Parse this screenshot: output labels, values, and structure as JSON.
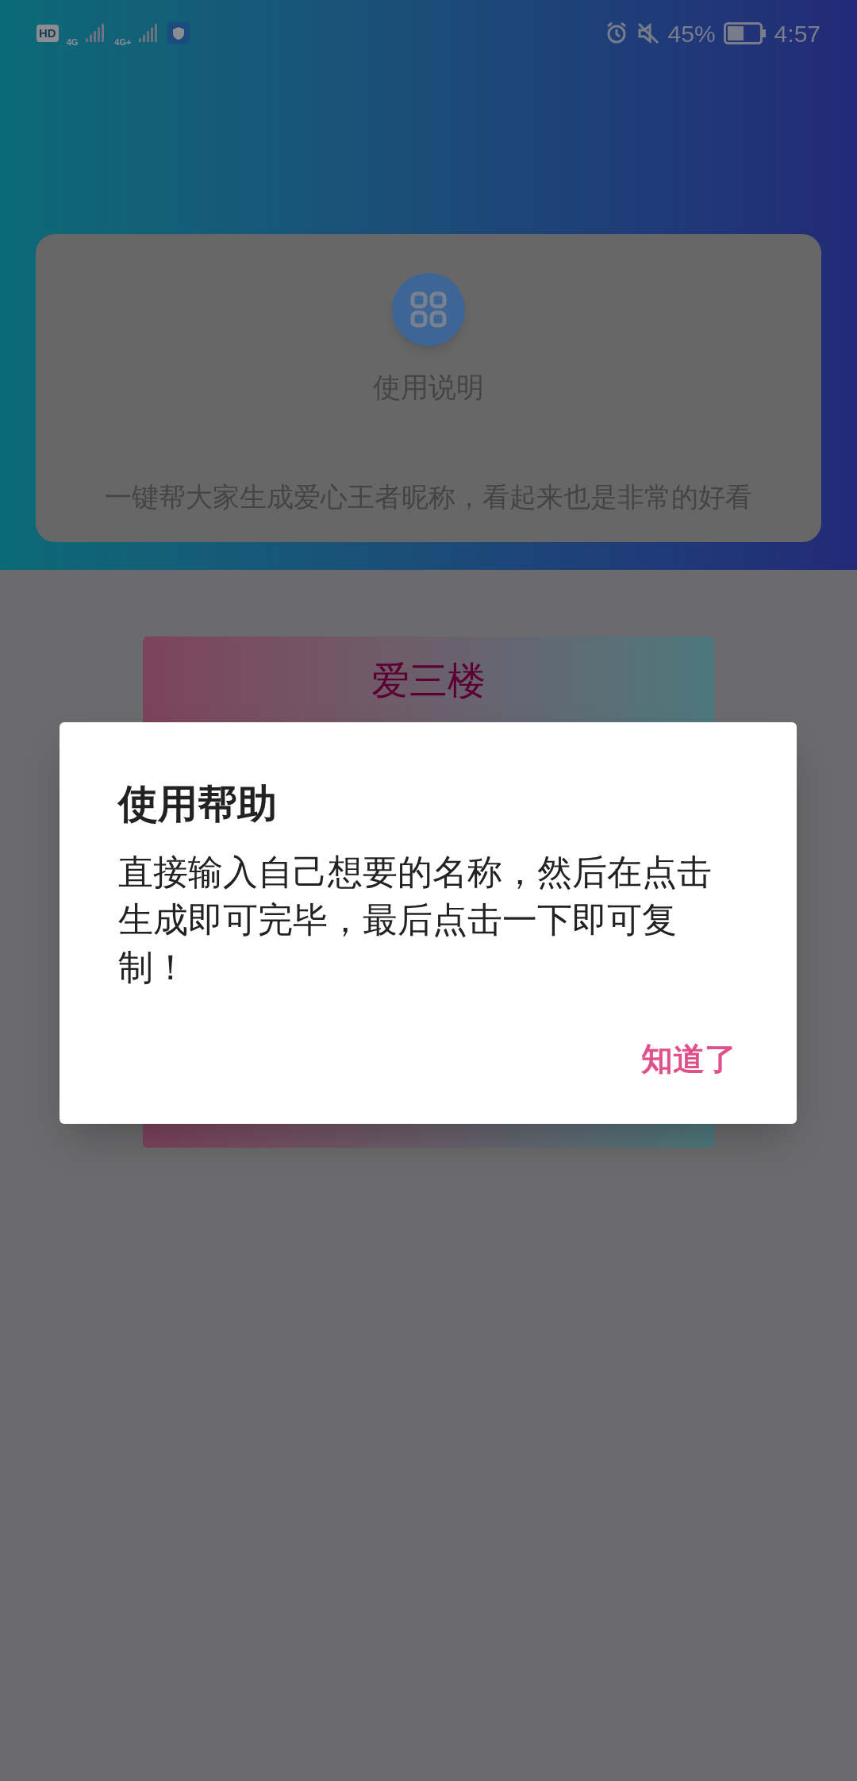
{
  "status_bar": {
    "hd": "HD",
    "network_1": "4G",
    "network_2": "4G+",
    "battery": "45%",
    "time": "4:57"
  },
  "info_card": {
    "title": "使用说明",
    "description": "一键帮大家生成爱心王者昵称，看起来也是非常的好看"
  },
  "name_card": {
    "title": "爱三楼"
  },
  "dialog": {
    "title": "使用帮助",
    "message": "直接输入自己想要的名称，然后在点击生成即可完毕，最后点击一下即可复制！",
    "button": "知道了"
  }
}
